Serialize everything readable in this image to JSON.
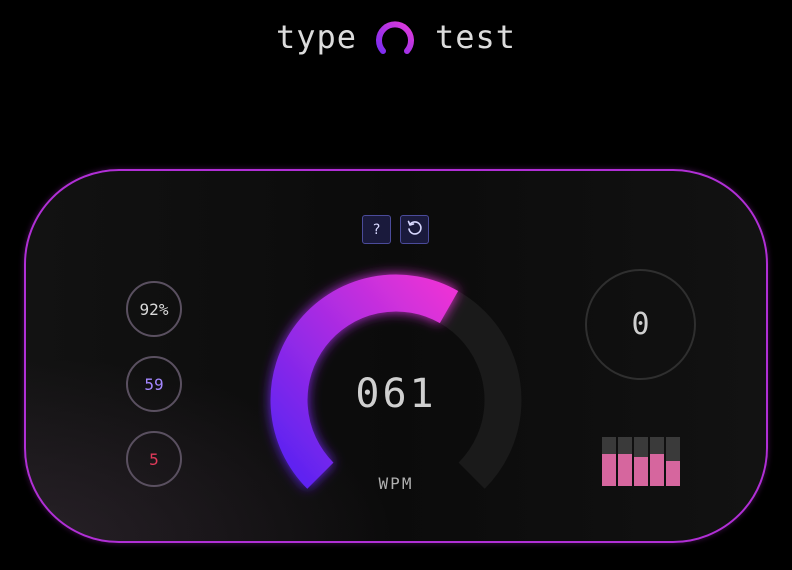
{
  "header": {
    "title_left": "type",
    "title_right": "test",
    "logo": {
      "icon": "loading-ring-icon",
      "colors": [
        "#7b2cf0",
        "#e23bd9"
      ]
    }
  },
  "controls": {
    "help_label": "?",
    "restart_icon": "restart-icon"
  },
  "stats": {
    "accuracy": "92%",
    "cpm": "59",
    "errors": "5"
  },
  "gauge": {
    "value_text": "061",
    "unit": "WPM",
    "level": 0.61,
    "colors": {
      "start": "#5a23f2",
      "end": "#ea33d6",
      "track": "#1a1a1a"
    }
  },
  "timer": {
    "value": "0"
  },
  "bars": {
    "levels": [
      0.65,
      0.65,
      0.6,
      0.65,
      0.5
    ],
    "fill_color": "#d6669e",
    "track_color": "#3a3a3a"
  },
  "theme": {
    "accent": "#b12fd6",
    "accuracy_color": "#d9d9d9",
    "cpm_color": "#a487ff",
    "errors_color": "#e03a5a"
  }
}
